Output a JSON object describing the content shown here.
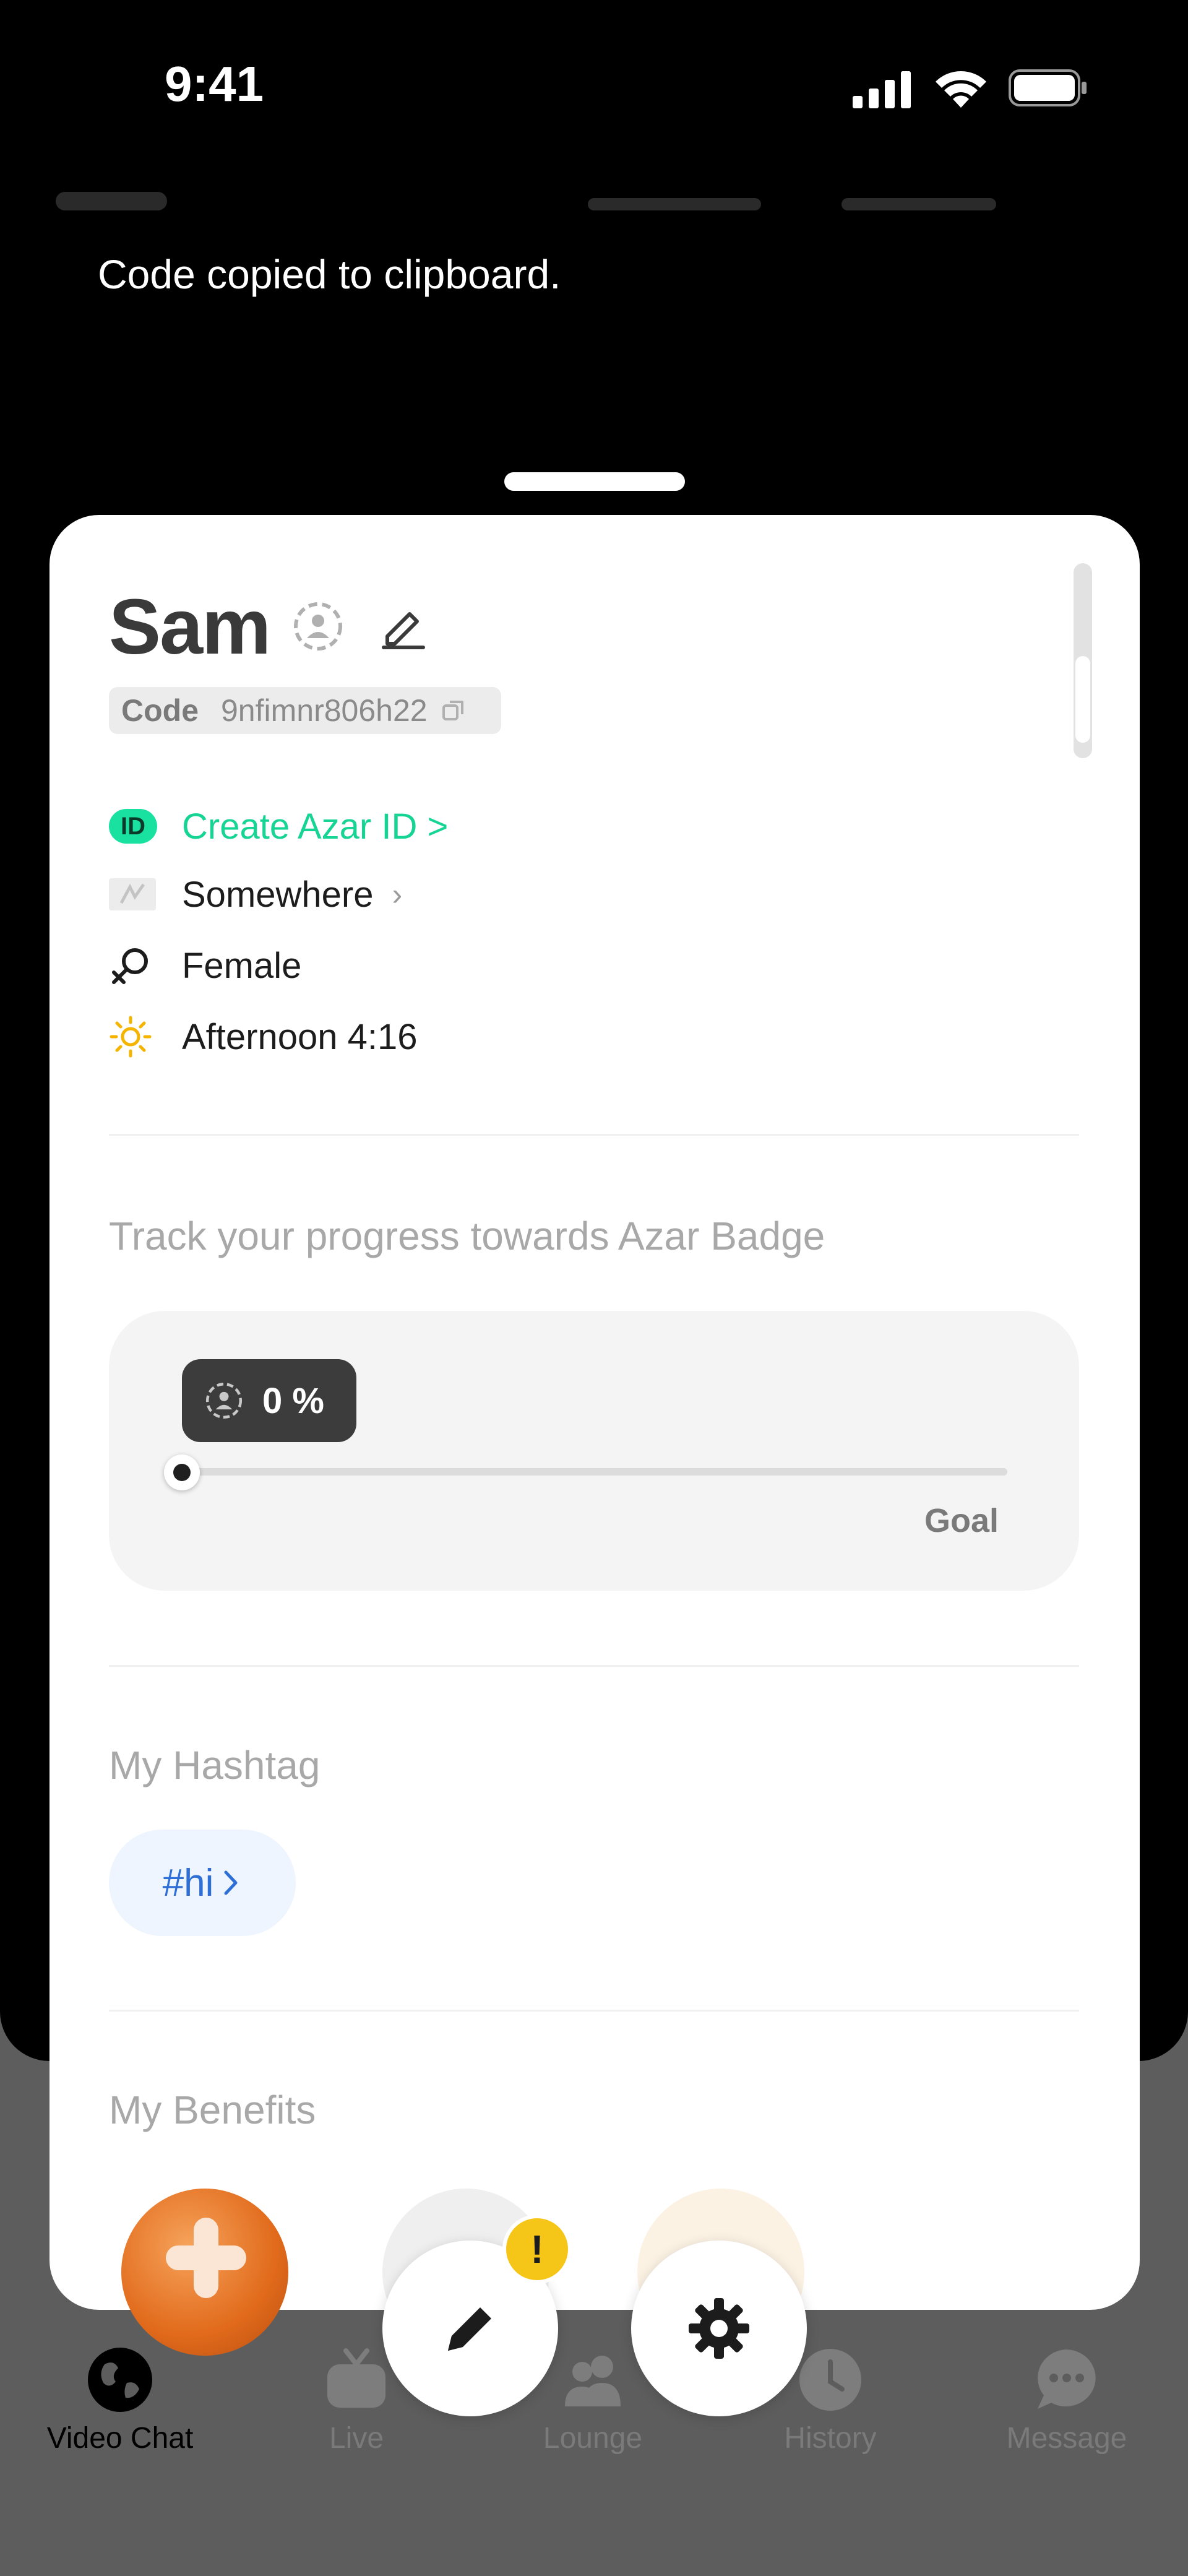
{
  "status_bar": {
    "time": "9:41"
  },
  "toast": {
    "message": "Code copied to clipboard."
  },
  "profile": {
    "name": "Sam",
    "code_label": "Code",
    "code_value": "9nfimnr806h22",
    "azar_id_link": "Create Azar ID >",
    "id_badge": "ID",
    "location": "Somewhere",
    "gender": "Female",
    "local_time": "Afternoon 4:16"
  },
  "badge_progress": {
    "title": "Track your progress towards Azar Badge",
    "percent_text": "0 %",
    "progress": 0,
    "goal_label": "Goal"
  },
  "hashtags": {
    "title": "My Hashtag",
    "items": [
      "#hi"
    ]
  },
  "benefits": {
    "title": "My Benefits"
  },
  "floating_actions": {
    "alert_symbol": "!"
  },
  "tabs": [
    {
      "label": "Video Chat",
      "icon": "globe-icon",
      "active": true
    },
    {
      "label": "Live",
      "icon": "tv-icon",
      "active": false
    },
    {
      "label": "Lounge",
      "icon": "people-icon",
      "active": false
    },
    {
      "label": "History",
      "icon": "clock-icon",
      "active": false
    },
    {
      "label": "Message",
      "icon": "chat-icon",
      "active": false
    }
  ],
  "colors": {
    "accent_green": "#16d494",
    "hashtag_blue": "#2d6fd6",
    "alert_yellow": "#f5c518"
  }
}
